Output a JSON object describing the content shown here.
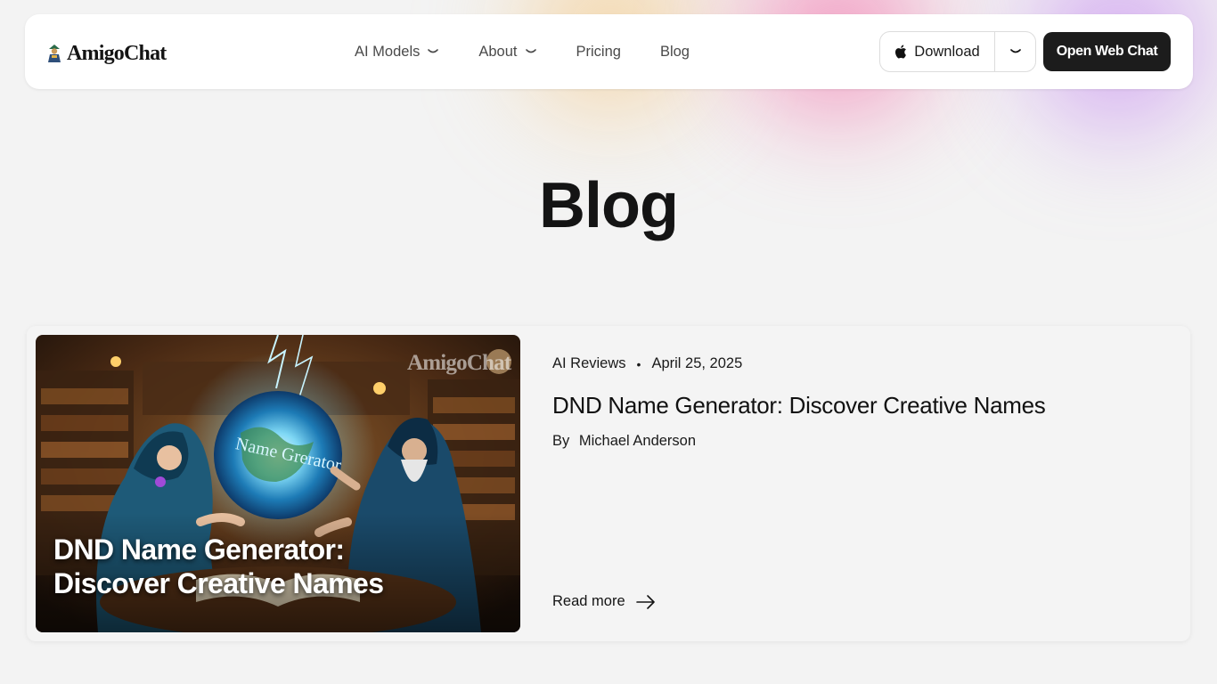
{
  "header": {
    "logo_text": "AmigoChat",
    "nav": [
      {
        "label": "AI Models",
        "icon": "chevron-down-icon"
      },
      {
        "label": "About",
        "icon": "chevron-down-icon"
      },
      {
        "label": "Pricing"
      },
      {
        "label": "Blog"
      }
    ],
    "download_label": "Download",
    "download_icon": "apple-icon",
    "open_web_chat_label": "Open Web Chat"
  },
  "page": {
    "title": "Blog"
  },
  "post": {
    "category": "AI Reviews",
    "date": "April 25, 2025",
    "title": "DND Name Generator: Discover Creative Names",
    "by_label": "By",
    "author": "Michael Anderson",
    "read_more_label": "Read more",
    "thumbnail": {
      "overlay_title": "DND Name Generator: Discover Creative Names",
      "watermark": "AmigoChat",
      "orb_text": "Name Grerator"
    }
  },
  "colors": {
    "background": "#f3f3f3",
    "header_bg": "#ffffff",
    "primary_button": "#1c1c1c",
    "glow_orange": "#f6c478",
    "glow_pink": "#f368a5",
    "glow_purple": "#be78f0"
  }
}
